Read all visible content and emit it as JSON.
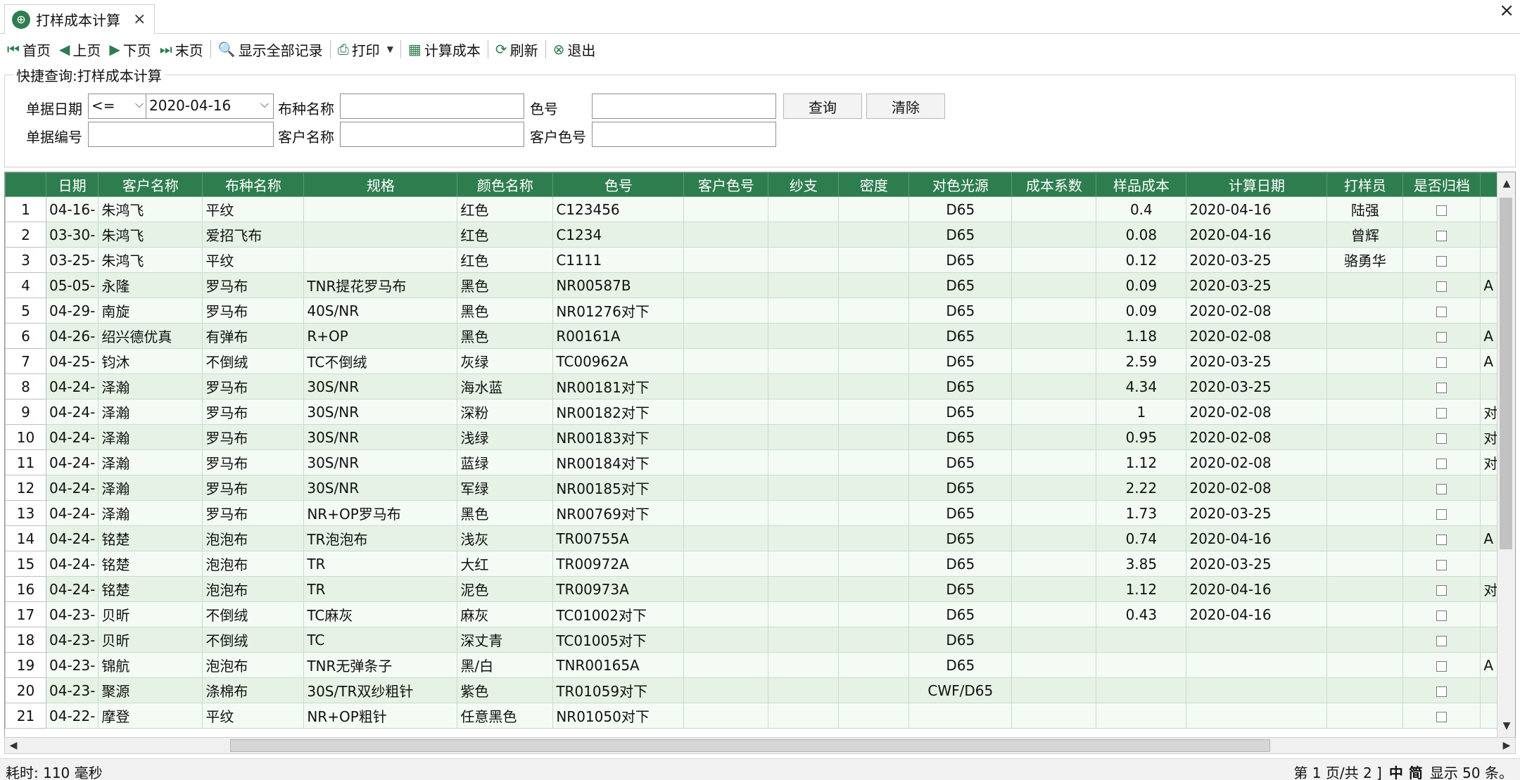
{
  "tab": {
    "title": "打样成本计算",
    "close": "×"
  },
  "window": {
    "close": "×"
  },
  "toolbar": {
    "first": "首页",
    "prev": "上页",
    "next": "下页",
    "last": "末页",
    "show_all": "显示全部记录",
    "print": "打印",
    "calc_cost": "计算成本",
    "refresh": "刷新",
    "exit": "退出"
  },
  "query": {
    "legend": "快捷查询:打样成本计算",
    "date_label": "单据日期",
    "date_op": "<=",
    "date_value": "2020-04-16",
    "fabric_label": "布种名称",
    "fabric_value": "",
    "color_no_label": "色号",
    "color_no_value": "",
    "doc_no_label": "单据编号",
    "doc_no_value": "",
    "customer_label": "客户名称",
    "customer_value": "",
    "cust_color_label": "客户色号",
    "cust_color_value": "",
    "search_btn": "查询",
    "clear_btn": "清除"
  },
  "grid": {
    "columns": [
      "日期",
      "客户名称",
      "布种名称",
      "规格",
      "颜色名称",
      "色号",
      "客户色号",
      "纱支",
      "密度",
      "对色光源",
      "成本系数",
      "样品成本",
      "计算日期",
      "打样员",
      "是否归档",
      ""
    ],
    "rows": [
      {
        "n": "1",
        "date": "-04-16",
        "customer": "朱鸿飞",
        "fabric": "平纹",
        "spec": "",
        "color": "红色",
        "color_no": "C123456",
        "light": "D65",
        "cost": "0.4",
        "calc_date": "2020-04-16",
        "sampler": "陆强",
        "extra": ""
      },
      {
        "n": "2",
        "date": "-03-30",
        "customer": "朱鸿飞",
        "fabric": "爱招飞布",
        "spec": "",
        "color": "红色",
        "color_no": "C1234",
        "light": "D65",
        "cost": "0.08",
        "calc_date": "2020-04-16",
        "sampler": "曾辉",
        "extra": ""
      },
      {
        "n": "3",
        "date": "-03-25",
        "customer": "朱鸿飞",
        "fabric": "平纹",
        "spec": "",
        "color": "红色",
        "color_no": "C1111",
        "light": "D65",
        "cost": "0.12",
        "calc_date": "2020-03-25",
        "sampler": "骆勇华",
        "extra": ""
      },
      {
        "n": "4",
        "date": "-05-05",
        "customer": "永隆",
        "fabric": "罗马布",
        "spec": "TNR提花罗马布",
        "color": "黑色",
        "color_no": "NR00587B",
        "light": "D65",
        "cost": "0.09",
        "calc_date": "2020-03-25",
        "sampler": "",
        "extra": "A"
      },
      {
        "n": "5",
        "date": "-04-29",
        "customer": "南旋",
        "fabric": "罗马布",
        "spec": "40S/NR",
        "color": "黑色",
        "color_no": "NR01276对下",
        "light": "D65",
        "cost": "0.09",
        "calc_date": "2020-02-08",
        "sampler": "",
        "extra": ""
      },
      {
        "n": "6",
        "date": "-04-26",
        "customer": "绍兴德优真",
        "fabric": "有弹布",
        "spec": "R+OP",
        "color": "黑色",
        "color_no": "R00161A",
        "light": "D65",
        "cost": "1.18",
        "calc_date": "2020-02-08",
        "sampler": "",
        "extra": "A"
      },
      {
        "n": "7",
        "date": "-04-25",
        "customer": "钧沐",
        "fabric": "不倒绒",
        "spec": "TC不倒绒",
        "color": "灰绿",
        "color_no": "TC00962A",
        "light": "D65",
        "cost": "2.59",
        "calc_date": "2020-03-25",
        "sampler": "",
        "extra": "A"
      },
      {
        "n": "8",
        "date": "-04-24",
        "customer": "泽瀚",
        "fabric": "罗马布",
        "spec": "30S/NR",
        "color": "海水蓝",
        "color_no": "NR00181对下",
        "light": "D65",
        "cost": "4.34",
        "calc_date": "2020-03-25",
        "sampler": "",
        "extra": ""
      },
      {
        "n": "9",
        "date": "-04-24",
        "customer": "泽瀚",
        "fabric": "罗马布",
        "spec": "30S/NR",
        "color": "深粉",
        "color_no": "NR00182对下",
        "light": "D65",
        "cost": "1",
        "calc_date": "2020-02-08",
        "sampler": "",
        "extra": "对"
      },
      {
        "n": "10",
        "date": "-04-24",
        "customer": "泽瀚",
        "fabric": "罗马布",
        "spec": "30S/NR",
        "color": "浅绿",
        "color_no": "NR00183对下",
        "light": "D65",
        "cost": "0.95",
        "calc_date": "2020-02-08",
        "sampler": "",
        "extra": "对"
      },
      {
        "n": "11",
        "date": "-04-24",
        "customer": "泽瀚",
        "fabric": "罗马布",
        "spec": "30S/NR",
        "color": "蓝绿",
        "color_no": "NR00184对下",
        "light": "D65",
        "cost": "1.12",
        "calc_date": "2020-02-08",
        "sampler": "",
        "extra": "对"
      },
      {
        "n": "12",
        "date": "-04-24",
        "customer": "泽瀚",
        "fabric": "罗马布",
        "spec": "30S/NR",
        "color": "军绿",
        "color_no": "NR00185对下",
        "light": "D65",
        "cost": "2.22",
        "calc_date": "2020-02-08",
        "sampler": "",
        "extra": ""
      },
      {
        "n": "13",
        "date": "-04-24",
        "customer": "泽瀚",
        "fabric": "罗马布",
        "spec": "NR+OP罗马布",
        "color": "黑色",
        "color_no": "NR00769对下",
        "light": "D65",
        "cost": "1.73",
        "calc_date": "2020-03-25",
        "sampler": "",
        "extra": ""
      },
      {
        "n": "14",
        "date": "-04-24",
        "customer": "铭楚",
        "fabric": "泡泡布",
        "spec": "TR泡泡布",
        "color": "浅灰",
        "color_no": "TR00755A",
        "light": "D65",
        "cost": "0.74",
        "calc_date": "2020-04-16",
        "sampler": "",
        "extra": "A"
      },
      {
        "n": "15",
        "date": "-04-24",
        "customer": "铭楚",
        "fabric": "泡泡布",
        "spec": "TR",
        "color": "大红",
        "color_no": "TR00972A",
        "light": "D65",
        "cost": "3.85",
        "calc_date": "2020-03-25",
        "sampler": "",
        "extra": ""
      },
      {
        "n": "16",
        "date": "-04-24",
        "customer": "铭楚",
        "fabric": "泡泡布",
        "spec": "TR",
        "color": "泥色",
        "color_no": "TR00973A",
        "light": "D65",
        "cost": "1.12",
        "calc_date": "2020-04-16",
        "sampler": "",
        "extra": "对"
      },
      {
        "n": "17",
        "date": "-04-23",
        "customer": "贝昕",
        "fabric": "不倒绒",
        "spec": "TC麻灰",
        "color": "麻灰",
        "color_no": "TC01002对下",
        "light": "D65",
        "cost": "0.43",
        "calc_date": "2020-04-16",
        "sampler": "",
        "extra": ""
      },
      {
        "n": "18",
        "date": "-04-23",
        "customer": "贝昕",
        "fabric": "不倒绒",
        "spec": "TC",
        "color": "深丈青",
        "color_no": "TC01005对下",
        "light": "D65",
        "cost": "",
        "calc_date": "",
        "sampler": "",
        "extra": ""
      },
      {
        "n": "19",
        "date": "-04-23",
        "customer": "锦航",
        "fabric": "泡泡布",
        "spec": "TNR无弹条子",
        "color": "黑/白",
        "color_no": "TNR00165A",
        "light": "D65",
        "cost": "",
        "calc_date": "",
        "sampler": "",
        "extra": "A"
      },
      {
        "n": "20",
        "date": "-04-23",
        "customer": "聚源",
        "fabric": "涤棉布",
        "spec": "30S/TR双纱粗针",
        "color": "紫色",
        "color_no": "TR01059对下",
        "light": "CWF/D65",
        "cost": "",
        "calc_date": "",
        "sampler": "",
        "extra": ""
      },
      {
        "n": "21",
        "date": "-04-22",
        "customer": "摩登",
        "fabric": "平纹",
        "spec": "NR+OP粗针",
        "color": "任意黑色",
        "color_no": "NR01050对下",
        "light": "",
        "cost": "",
        "calc_date": "",
        "sampler": "",
        "extra": ""
      }
    ]
  },
  "status": {
    "elapsed": "耗时: 110 毫秒",
    "page": "第 1 页/共 2 ]",
    "ime": [
      "中",
      "简"
    ],
    "per_page": "显示 50 条。"
  },
  "colors": {
    "header": "#2e7d4f",
    "row_odd": "#f4fbf4",
    "row_even": "#e6f2e6"
  }
}
